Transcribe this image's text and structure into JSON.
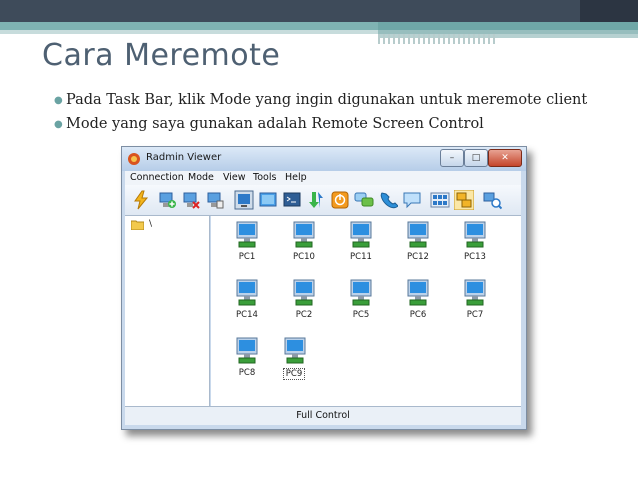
{
  "slide": {
    "title": "Cara Meremote",
    "bullets": [
      "Pada Task Bar, klik Mode yang ingin digunakan untuk meremote client",
      "Mode yang saya gunakan adalah Remote Screen Control"
    ]
  },
  "window": {
    "title": "Radmin Viewer",
    "menu": [
      "Connection",
      "Mode",
      "View",
      "Tools",
      "Help"
    ],
    "toolbar_icons": [
      "connect-icon",
      "add-connection-icon",
      "delete-connection-icon",
      "properties-icon",
      "full-control-mode-icon",
      "view-only-mode-icon",
      "telnet-mode-icon",
      "file-transfer-mode-icon",
      "shutdown-mode-icon",
      "chat-mode-icon",
      "voice-chat-mode-icon",
      "text-message-mode-icon",
      "small-icons-view-icon",
      "large-icons-view-icon",
      "scan-network-icon"
    ],
    "tree_root": "\\",
    "computers": [
      "PC1",
      "PC10",
      "PC11",
      "PC12",
      "PC13",
      "PC14",
      "PC2",
      "PC5",
      "PC6",
      "PC7",
      "PC8",
      "PC9"
    ],
    "selected_computer": "PC9",
    "status": "Full Control"
  },
  "colors": {
    "highlight_box": "#e8141b",
    "accent": "#7fb3b3",
    "title_text": "#4e6072"
  }
}
